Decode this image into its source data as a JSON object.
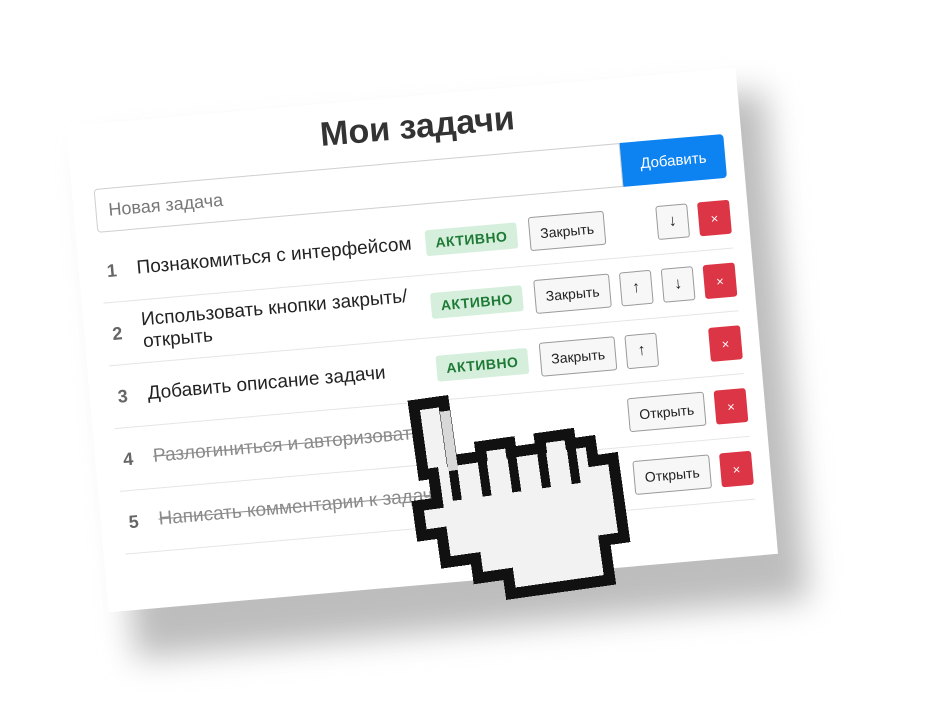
{
  "app": {
    "title": "Мои задачи",
    "new_task": {
      "placeholder": "Новая задача",
      "value": ""
    },
    "add_button_label": "Добавить"
  },
  "tasks": [
    {
      "number": "1",
      "text": "Познакомиться с интерфейсом",
      "done": false,
      "status": "АКТИВНО",
      "action": "Закрыть",
      "up": false,
      "down": true,
      "up_label": "↑",
      "down_label": "↓",
      "delete_label": "×"
    },
    {
      "number": "2",
      "text": "Использовать кнопки закрыть/открыть",
      "done": false,
      "status": "АКТИВНО",
      "action": "Закрыть",
      "up": true,
      "down": true,
      "up_label": "↑",
      "down_label": "↓",
      "delete_label": "×"
    },
    {
      "number": "3",
      "text": "Добавить описание задачи",
      "done": false,
      "status": "АКТИВНО",
      "action": "Закрыть",
      "up": true,
      "down": false,
      "up_label": "↑",
      "down_label": "↓",
      "delete_label": "×"
    },
    {
      "number": "4",
      "text": "Разлогиниться и авторизоваться",
      "done": true,
      "status": "",
      "action": "Открыть",
      "up": false,
      "down": false,
      "up_label": "↑",
      "down_label": "↓",
      "delete_label": "×"
    },
    {
      "number": "5",
      "text": "Написать комментарии к задаче",
      "done": true,
      "status": "",
      "action": "Открыть",
      "up": false,
      "down": false,
      "up_label": "↑",
      "down_label": "↓",
      "delete_label": "×"
    }
  ],
  "colors": {
    "primary": "#0d83f2",
    "danger": "#dc3545",
    "active_badge_bg": "#d6efdc",
    "active_badge_text": "#1f7a36"
  },
  "icons": {
    "cursor": "hand-pointer-cursor-icon"
  }
}
